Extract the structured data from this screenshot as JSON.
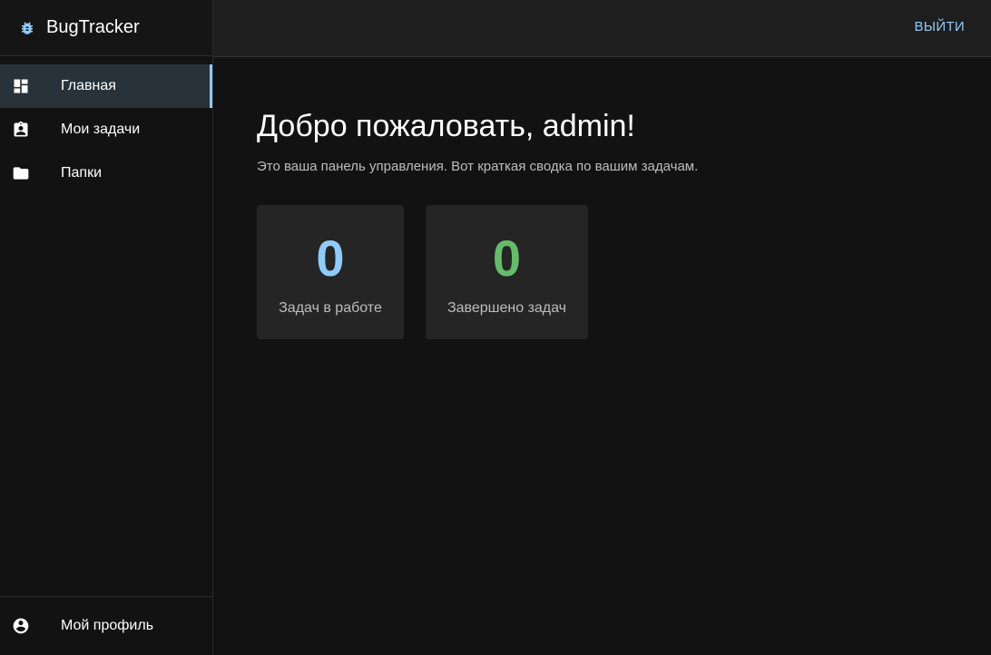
{
  "app": {
    "name": "BugTracker",
    "icon": "bug-icon"
  },
  "header": {
    "logout_label": "ВЫЙТИ"
  },
  "sidebar": {
    "items": [
      {
        "label": "Главная",
        "icon": "dashboard-icon",
        "active": true
      },
      {
        "label": "Мои задачи",
        "icon": "assignment-icon",
        "active": false
      },
      {
        "label": "Папки",
        "icon": "folder-icon",
        "active": false
      }
    ],
    "profile": {
      "label": "Мой профиль",
      "icon": "account-circle-icon"
    }
  },
  "main": {
    "title": "Добро пожаловать, admin!",
    "subtitle": "Это ваша панель управления. Вот краткая сводка по вашим задачам.",
    "stats": [
      {
        "value": "0",
        "label": "Задач в работе",
        "color": "#90caf9"
      },
      {
        "value": "0",
        "label": "Завершено задач",
        "color": "#66bb6a"
      }
    ]
  },
  "colors": {
    "accent": "#90caf9",
    "success": "#66bb6a",
    "background": "#121212",
    "card": "#252525"
  }
}
